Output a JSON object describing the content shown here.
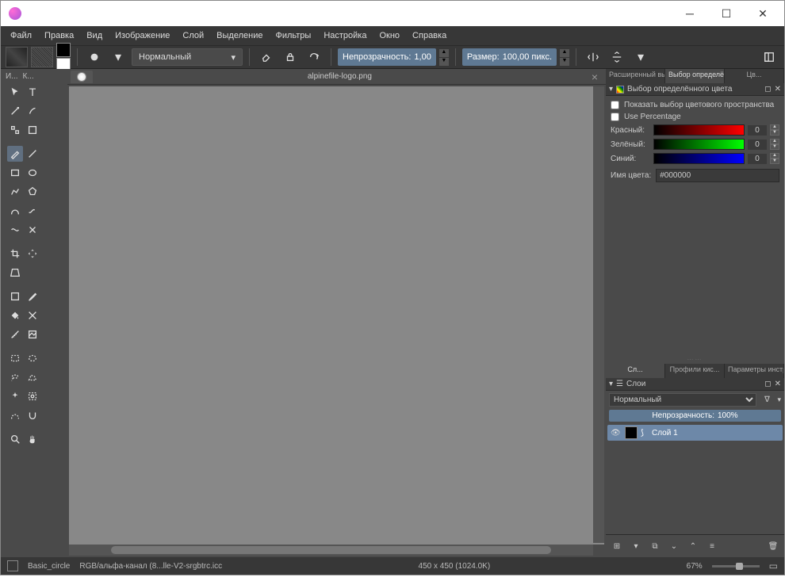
{
  "menubar": [
    "Файл",
    "Правка",
    "Вид",
    "Изображение",
    "Слой",
    "Выделение",
    "Фильтры",
    "Настройка",
    "Окно",
    "Справка"
  ],
  "toolbar": {
    "blend_mode": "Нормальный",
    "opacity_label": "Непрозрачность:",
    "opacity_value": "1,00",
    "size_label": "Размер:",
    "size_value": "100,00 пикс."
  },
  "canvas": {
    "filename": "alpinefile-logo.png"
  },
  "toolbox_header": [
    "И...",
    "К..."
  ],
  "right_panel": {
    "tabs_top": [
      "Расширенный вы...",
      "Выбор определён...",
      "Цв..."
    ],
    "color_selector_title": "Выбор определённого цвета",
    "show_colorspace": "Показать выбор цветового пространства",
    "use_percentage": "Use Percentage",
    "channels": [
      {
        "label": "Красный:",
        "value": "0",
        "gradient": "linear-gradient(to right,#000,#f00)"
      },
      {
        "label": "Зелёный:",
        "value": "0",
        "gradient": "linear-gradient(to right,#000,#0f0)"
      },
      {
        "label": "Синий:",
        "value": "0",
        "gradient": "linear-gradient(to right,#000,#00f)"
      }
    ],
    "color_name_label": "Имя цвета:",
    "color_name": "#000000",
    "tabs_mid": [
      "Сл...",
      "Профили кис...",
      "Параметры инструме..."
    ],
    "layers_title": "Слои",
    "layer_blend": "Нормальный",
    "layer_opacity_label": "Непрозрачность:",
    "layer_opacity_value": "100%",
    "layer_name": "Слой 1"
  },
  "statusbar": {
    "brush": "Basic_circle",
    "colorspace": "RGB/альфа-канал (8...lle-V2-srgbtrc.icc",
    "dimensions": "450 x 450 (1024.0K)",
    "zoom": "67%"
  }
}
